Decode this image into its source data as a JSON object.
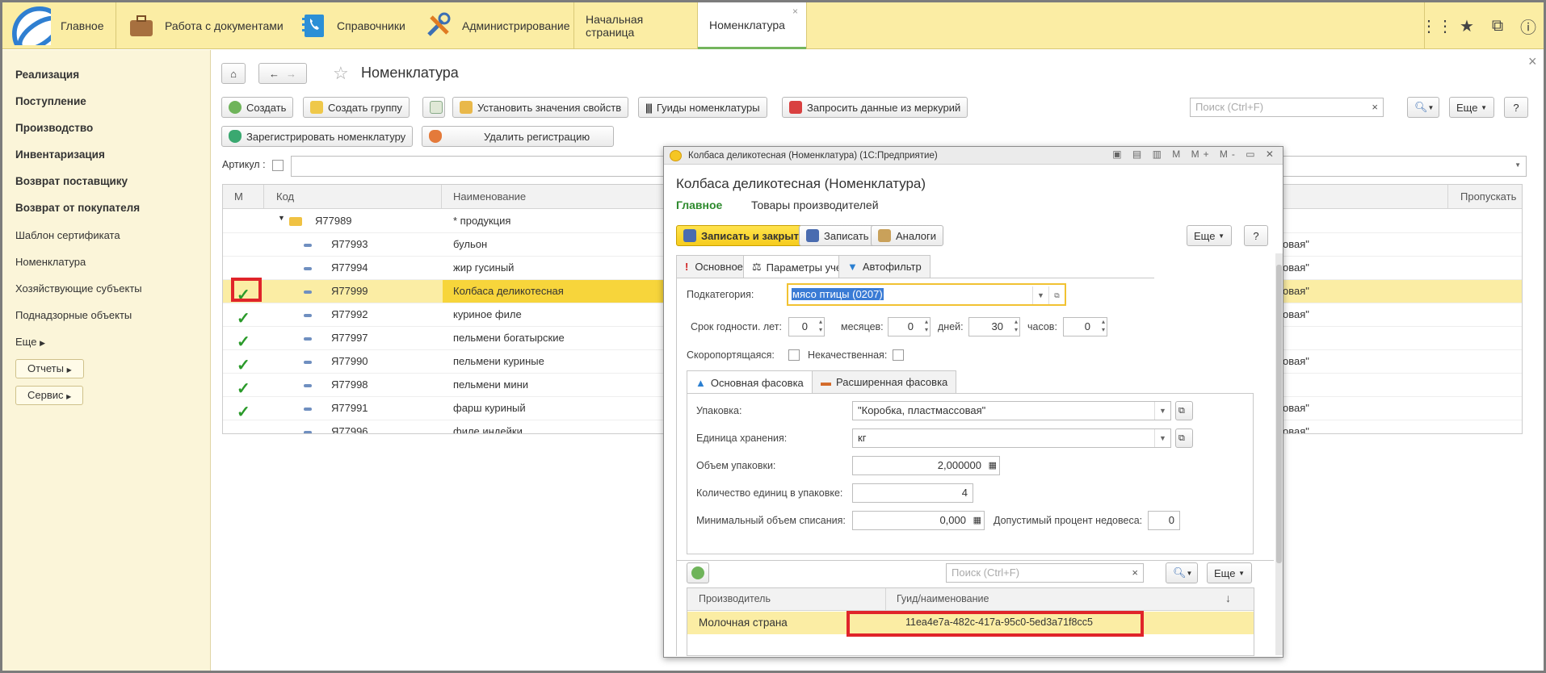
{
  "topbar": {
    "main_label": "Главное",
    "sections": [
      "Работа с документами",
      "Справочники",
      "Администрирование"
    ],
    "open_tabs": [
      "Начальная страница",
      "Номенклатура"
    ],
    "close_glyph": "×"
  },
  "sidebar": {
    "bold_items": [
      "Реализация",
      "Поступление",
      "Производство",
      "Инвентаризация",
      "Возврат поставщику",
      "Возврат от покупателя"
    ],
    "items": [
      "Шаблон сертификата",
      "Номенклатура",
      "Хозяйствующие субъекты",
      "Поднадзорные объекты",
      "Еще"
    ],
    "buttons": [
      "Отчеты",
      "Сервис"
    ]
  },
  "page": {
    "title": "Номенклатура",
    "close_glyph": "×",
    "toolbar1": [
      "Создать",
      "Создать группу",
      "Установить значения свойств",
      "Гуиды номенклатуры",
      "Запросить данные из меркурий"
    ],
    "toolbar2": [
      "Зарегистрировать номенклатуру",
      "Удалить регистрацию"
    ],
    "search_placeholder": "Поиск (Ctrl+F)",
    "search_clear": "×",
    "more_label": "Еще",
    "help_label": "?",
    "article_label": "Артикул :"
  },
  "grid": {
    "columns": [
      "М",
      "Код",
      "Наименование",
      "Пропускать"
    ],
    "rows": [
      {
        "code": "Я77989",
        "name": "* продукция",
        "checked": false,
        "tail": ""
      },
      {
        "code": "Я77993",
        "name": "бульон",
        "checked": false,
        "tail": "овая\""
      },
      {
        "code": "Я77994",
        "name": "жир гусиный",
        "checked": false,
        "tail": "овая\""
      },
      {
        "code": "Я77999",
        "name": "Колбаса деликотесная",
        "checked": true,
        "tail": "овая\""
      },
      {
        "code": "Я77992",
        "name": "куриное филе",
        "checked": true,
        "tail": "овая\""
      },
      {
        "code": "Я77997",
        "name": "пельмени богатырские",
        "checked": true,
        "tail": ""
      },
      {
        "code": "Я77990",
        "name": "пельмени куриные",
        "checked": true,
        "tail": "овая\""
      },
      {
        "code": "Я77998",
        "name": "пельмени мини",
        "checked": true,
        "tail": ""
      },
      {
        "code": "Я77991",
        "name": "фарш куриный",
        "checked": true,
        "tail": "овая\""
      },
      {
        "code": "Я77996",
        "name": "филе индейки",
        "checked": false,
        "tail": "овая\""
      }
    ]
  },
  "dialog": {
    "window_title": "Колбаса деликотесная (Номенклатура)  (1С:Предприятие)",
    "window_icons": "▣ ▤ ▥ M M+ M- ▭ ✕",
    "heading": "Колбаса деликотесная (Номенклатура)",
    "nav": [
      "Главное",
      "Товары производителей"
    ],
    "buttons": {
      "save_close": "Записать и закрыть",
      "save": "Записать",
      "analogs": "Аналоги",
      "more": "Еще",
      "help": "?"
    },
    "tabs": [
      "Основное",
      "Параметры учета",
      "Автофильтр"
    ],
    "subcategory_label": "Подкатегория:",
    "subcategory_value": "мясо птицы (0207)",
    "shelf": {
      "years_label": "Срок годности. лет:",
      "years": "0",
      "months_label": "месяцев:",
      "months": "0",
      "days_label": "дней:",
      "days": "30",
      "hours_label": "часов:",
      "hours": "0"
    },
    "perishable_label": "Скоропортящаяся:",
    "defective_label": "Некачественная:",
    "pack_tabs": [
      "Основная фасовка",
      "Расширенная фасовка"
    ],
    "pack": {
      "package_label": "Упаковка:",
      "package_value": "\"Коробка, пластмассовая\"",
      "unit_label": "Единица хранения:",
      "unit_value": "кг",
      "volume_label": "Объем упаковки:",
      "volume_value": "2,000000",
      "count_label": "Количество единиц в упаковке:",
      "count_value": "4",
      "minvol_label": "Минимальный объем списания:",
      "minvol_value": "0,000",
      "shortage_label": "Допустимый процент недовеса:",
      "shortage_value": "0"
    },
    "search_placeholder": "Поиск (Ctrl+F)",
    "more_label": "Еще",
    "table_cols": [
      "Производитель",
      "Гуид/наименование"
    ],
    "table_rows": [
      {
        "producer": "Молочная страна",
        "guid": "11ea4e7a-482c-417a-95c0-5ed3a71f8cc5"
      }
    ]
  }
}
